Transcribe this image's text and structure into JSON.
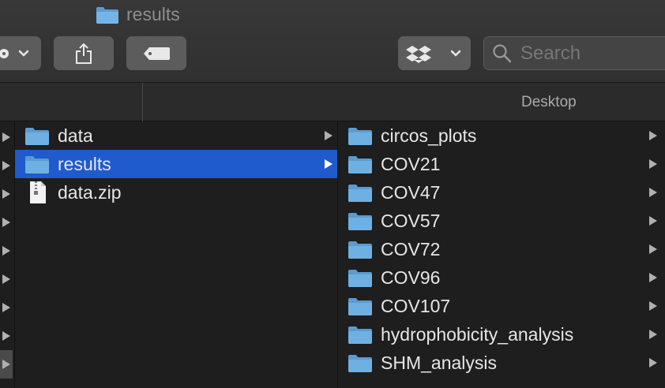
{
  "window": {
    "title": "results"
  },
  "toolbar": {
    "search_placeholder": "Search"
  },
  "pathbar": {
    "location": "Desktop"
  },
  "column1": {
    "items": [
      {
        "label": "data",
        "type": "folder"
      },
      {
        "label": "results",
        "type": "folder",
        "selected": true
      },
      {
        "label": "data.zip",
        "type": "zip-file"
      }
    ]
  },
  "column2": {
    "items": [
      {
        "label": "circos_plots"
      },
      {
        "label": "COV21"
      },
      {
        "label": "COV47"
      },
      {
        "label": "COV57"
      },
      {
        "label": "COV72"
      },
      {
        "label": "COV96"
      },
      {
        "label": "COV107"
      },
      {
        "label": "hydrophobicity_analysis"
      },
      {
        "label": "SHM_analysis"
      }
    ]
  },
  "colors": {
    "selection": "#1f5bcc",
    "folder": "#68aee0"
  }
}
